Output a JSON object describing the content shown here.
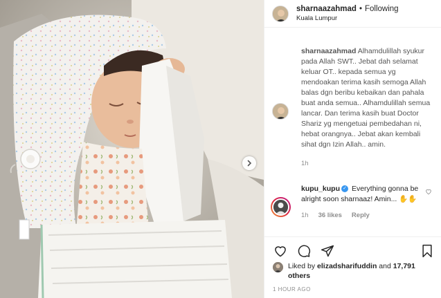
{
  "post": {
    "author": "sharnaazahmad",
    "separator": "•",
    "follow_label": "Following",
    "location": "Kuala Lumpur"
  },
  "caption": {
    "username": "sharnaazahmad",
    "text": "Alhamdulillah syukur pada Allah SWT.. Jebat dah selamat keluar OT.. kepada semua yg mendoakan terima kasih semoga Allah balas dgn beribu kebaikan dan pahala buat anda semua.. Alhamdulillah semua lancar. Dan terima kasih buat Doctor Shariz yg mengetuai pembedahan ni, hebat orangnya.. Jebat akan kembali sihat dgn Izin Allah.. amin.",
    "age": "1h"
  },
  "reply": {
    "username": "kupu_kupu",
    "verified_mark": "✓",
    "text": "Everything gonna be alright soon sharnaaz! Amin... ✋✋",
    "age": "1h",
    "likes": "36 likes",
    "reply_label": "Reply"
  },
  "likes": {
    "prefix": "Liked by",
    "user": "elizadsharifuddin",
    "connector": "and",
    "others": "17,791 others"
  },
  "timestamp": "1 HOUR AGO",
  "colors": {
    "verified": "#3897f0",
    "border": "#efefef",
    "muted": "#8e8e8e",
    "text": "#262626"
  },
  "icons": {
    "like": "heart-icon",
    "comment": "comment-icon",
    "share": "share-icon",
    "save": "bookmark-icon",
    "next": "chevron-right-icon"
  }
}
